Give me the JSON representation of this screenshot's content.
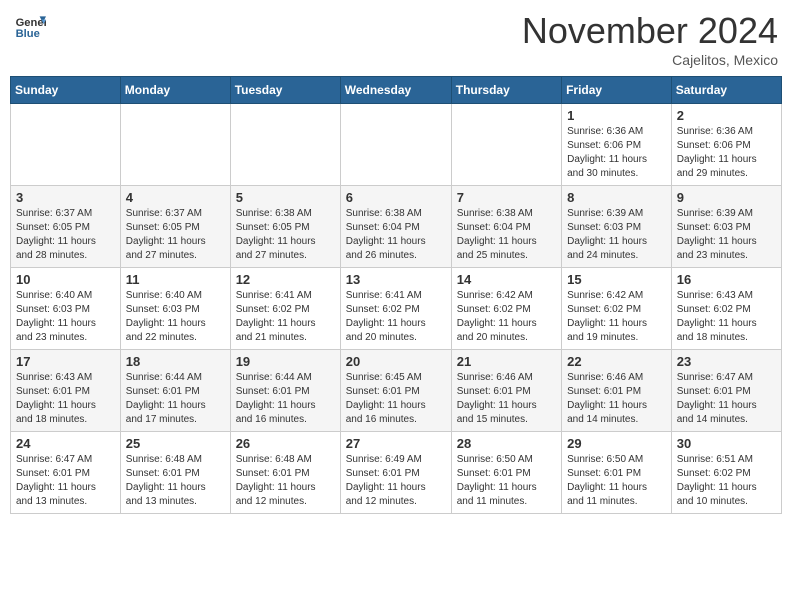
{
  "logo": {
    "general": "General",
    "blue": "Blue"
  },
  "header": {
    "month": "November 2024",
    "location": "Cajelitos, Mexico"
  },
  "weekdays": [
    "Sunday",
    "Monday",
    "Tuesday",
    "Wednesday",
    "Thursday",
    "Friday",
    "Saturday"
  ],
  "weeks": [
    [
      {
        "day": "",
        "info": ""
      },
      {
        "day": "",
        "info": ""
      },
      {
        "day": "",
        "info": ""
      },
      {
        "day": "",
        "info": ""
      },
      {
        "day": "",
        "info": ""
      },
      {
        "day": "1",
        "info": "Sunrise: 6:36 AM\nSunset: 6:06 PM\nDaylight: 11 hours\nand 30 minutes."
      },
      {
        "day": "2",
        "info": "Sunrise: 6:36 AM\nSunset: 6:06 PM\nDaylight: 11 hours\nand 29 minutes."
      }
    ],
    [
      {
        "day": "3",
        "info": "Sunrise: 6:37 AM\nSunset: 6:05 PM\nDaylight: 11 hours\nand 28 minutes."
      },
      {
        "day": "4",
        "info": "Sunrise: 6:37 AM\nSunset: 6:05 PM\nDaylight: 11 hours\nand 27 minutes."
      },
      {
        "day": "5",
        "info": "Sunrise: 6:38 AM\nSunset: 6:05 PM\nDaylight: 11 hours\nand 27 minutes."
      },
      {
        "day": "6",
        "info": "Sunrise: 6:38 AM\nSunset: 6:04 PM\nDaylight: 11 hours\nand 26 minutes."
      },
      {
        "day": "7",
        "info": "Sunrise: 6:38 AM\nSunset: 6:04 PM\nDaylight: 11 hours\nand 25 minutes."
      },
      {
        "day": "8",
        "info": "Sunrise: 6:39 AM\nSunset: 6:03 PM\nDaylight: 11 hours\nand 24 minutes."
      },
      {
        "day": "9",
        "info": "Sunrise: 6:39 AM\nSunset: 6:03 PM\nDaylight: 11 hours\nand 23 minutes."
      }
    ],
    [
      {
        "day": "10",
        "info": "Sunrise: 6:40 AM\nSunset: 6:03 PM\nDaylight: 11 hours\nand 23 minutes."
      },
      {
        "day": "11",
        "info": "Sunrise: 6:40 AM\nSunset: 6:03 PM\nDaylight: 11 hours\nand 22 minutes."
      },
      {
        "day": "12",
        "info": "Sunrise: 6:41 AM\nSunset: 6:02 PM\nDaylight: 11 hours\nand 21 minutes."
      },
      {
        "day": "13",
        "info": "Sunrise: 6:41 AM\nSunset: 6:02 PM\nDaylight: 11 hours\nand 20 minutes."
      },
      {
        "day": "14",
        "info": "Sunrise: 6:42 AM\nSunset: 6:02 PM\nDaylight: 11 hours\nand 20 minutes."
      },
      {
        "day": "15",
        "info": "Sunrise: 6:42 AM\nSunset: 6:02 PM\nDaylight: 11 hours\nand 19 minutes."
      },
      {
        "day": "16",
        "info": "Sunrise: 6:43 AM\nSunset: 6:02 PM\nDaylight: 11 hours\nand 18 minutes."
      }
    ],
    [
      {
        "day": "17",
        "info": "Sunrise: 6:43 AM\nSunset: 6:01 PM\nDaylight: 11 hours\nand 18 minutes."
      },
      {
        "day": "18",
        "info": "Sunrise: 6:44 AM\nSunset: 6:01 PM\nDaylight: 11 hours\nand 17 minutes."
      },
      {
        "day": "19",
        "info": "Sunrise: 6:44 AM\nSunset: 6:01 PM\nDaylight: 11 hours\nand 16 minutes."
      },
      {
        "day": "20",
        "info": "Sunrise: 6:45 AM\nSunset: 6:01 PM\nDaylight: 11 hours\nand 16 minutes."
      },
      {
        "day": "21",
        "info": "Sunrise: 6:46 AM\nSunset: 6:01 PM\nDaylight: 11 hours\nand 15 minutes."
      },
      {
        "day": "22",
        "info": "Sunrise: 6:46 AM\nSunset: 6:01 PM\nDaylight: 11 hours\nand 14 minutes."
      },
      {
        "day": "23",
        "info": "Sunrise: 6:47 AM\nSunset: 6:01 PM\nDaylight: 11 hours\nand 14 minutes."
      }
    ],
    [
      {
        "day": "24",
        "info": "Sunrise: 6:47 AM\nSunset: 6:01 PM\nDaylight: 11 hours\nand 13 minutes."
      },
      {
        "day": "25",
        "info": "Sunrise: 6:48 AM\nSunset: 6:01 PM\nDaylight: 11 hours\nand 13 minutes."
      },
      {
        "day": "26",
        "info": "Sunrise: 6:48 AM\nSunset: 6:01 PM\nDaylight: 11 hours\nand 12 minutes."
      },
      {
        "day": "27",
        "info": "Sunrise: 6:49 AM\nSunset: 6:01 PM\nDaylight: 11 hours\nand 12 minutes."
      },
      {
        "day": "28",
        "info": "Sunrise: 6:50 AM\nSunset: 6:01 PM\nDaylight: 11 hours\nand 11 minutes."
      },
      {
        "day": "29",
        "info": "Sunrise: 6:50 AM\nSunset: 6:01 PM\nDaylight: 11 hours\nand 11 minutes."
      },
      {
        "day": "30",
        "info": "Sunrise: 6:51 AM\nSunset: 6:02 PM\nDaylight: 11 hours\nand 10 minutes."
      }
    ]
  ]
}
